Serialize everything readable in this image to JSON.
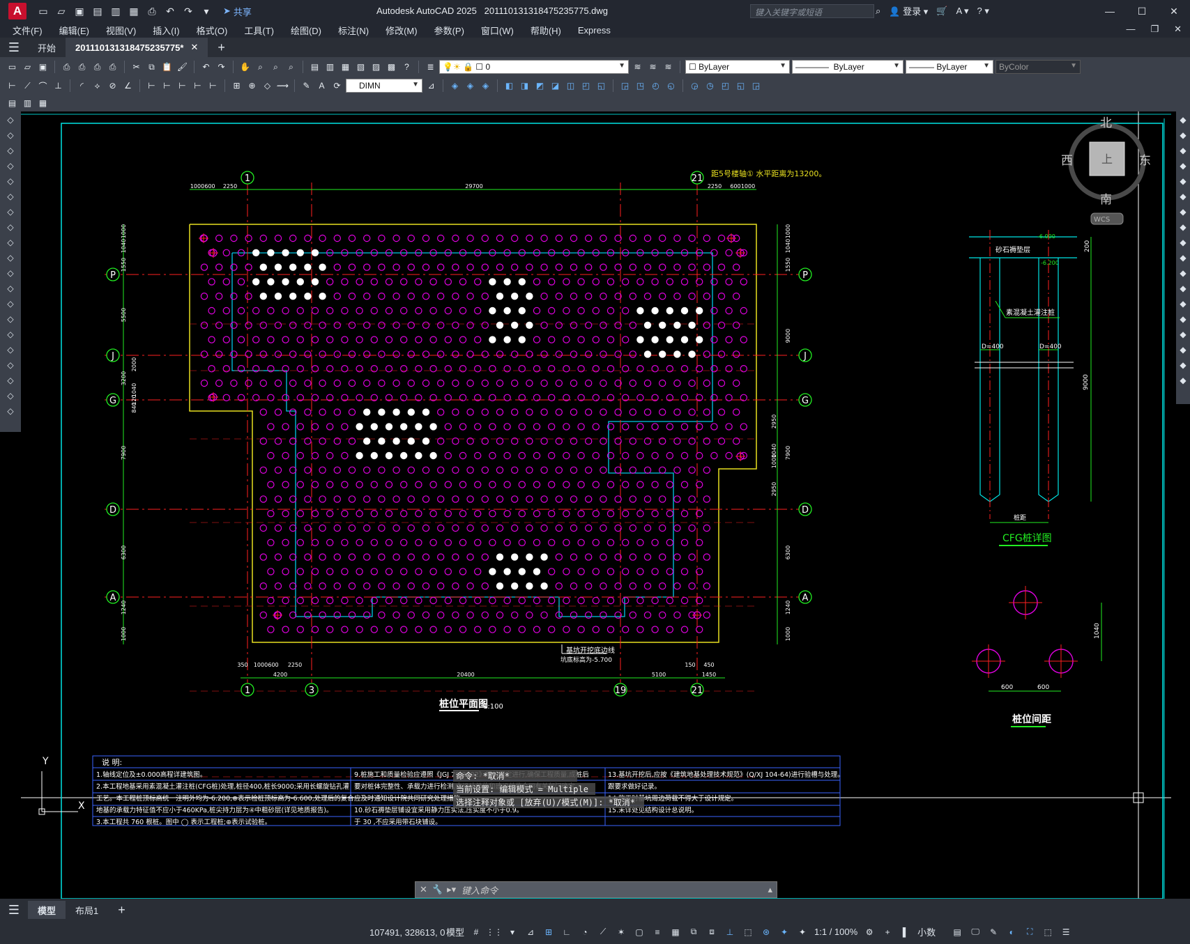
{
  "titlebar": {
    "logo": "A",
    "share": "共享",
    "app_title": "Autodesk AutoCAD 2025",
    "file_name": "20111013131847523577​5.dwg",
    "search_placeholder": "键入关键字或短语",
    "login": "登录"
  },
  "menu": [
    "文件(F)",
    "编辑(E)",
    "视图(V)",
    "插入(I)",
    "格式(O)",
    "工具(T)",
    "绘图(D)",
    "标注(N)",
    "修改(M)",
    "参数(P)",
    "窗口(W)",
    "帮助(H)",
    "Express"
  ],
  "tabs": {
    "start": "开始",
    "doc": "20111013131847523577​5*"
  },
  "toolbar": {
    "layer_value": "0",
    "color": "ByLayer",
    "linetype": "ByLayer",
    "lineweight": "ByLayer",
    "plotstyle": "ByColor",
    "dimstyle": "DIMN"
  },
  "viewcube": {
    "north": "北",
    "south": "南",
    "east": "东",
    "west": "西",
    "top": "上",
    "wcs": "WCS"
  },
  "drawing": {
    "plan_title": "桩位平面图",
    "plan_scale": "1:100",
    "detail_title": "CFG桩详图",
    "spacing_title": "桩位间距",
    "note_top": "距5号楼轴① 水平距离为13200。",
    "gravel_label": "砂石褥垫层",
    "concrete_label": "素混凝土灌注桩",
    "pile_dia_left": "D=400",
    "pile_dia_right": "D=400",
    "pile_spacing_label": "桩距",
    "depth_900": "9000",
    "elev_top": "-6.000",
    "elev_mid": "-6.200",
    "dim_200": "200",
    "dim_1040": "1040",
    "dim_600a": "600",
    "dim_600b": "600",
    "excavation_label": "基坑开挖底边线",
    "excavation_elev": "坑底标高为-5.700",
    "axes_h": [
      "P",
      "J",
      "G",
      "D",
      "A"
    ],
    "axes_v_top": [
      "1",
      "21"
    ],
    "axes_v_bottom": [
      "1",
      "3",
      "19",
      "21"
    ],
    "top_dims": [
      "1000",
      "600",
      "2250",
      "29700",
      "2250",
      "600",
      "1000"
    ],
    "bottom_dims": [
      "350",
      "1000",
      "600",
      "2250",
      "4200",
      "20400",
      "5100",
      "150",
      "450",
      "1450"
    ],
    "left_dims": [
      "1000",
      "1040",
      "1550",
      "5500",
      "3200",
      "2000",
      "1040",
      "120",
      "840",
      "7900",
      "6300",
      "1240",
      "1000"
    ],
    "right_dims": [
      "1000",
      "1040",
      "1550",
      "9000",
      "2950",
      "1040",
      "1000",
      "2950",
      "7900",
      "6300",
      "1240",
      "1000"
    ]
  },
  "notes": {
    "heading": "说 明:",
    "col1": [
      "1.轴线定位及±0.000高程详建筑图。",
      "2.本工程地基采用素混凝土灌注桩(CFG桩)处理,桩径400,桩长9000;采用长螺旋钻孔灌",
      "工艺。本工程桩顶标高统一注明外均为-6.200,⊕表示检桩顶标高为-6.600,处理后的复合",
      "地基的承载力特征值不应小于460KPa,桩尖持力层为④中粗砂层(详见地质报告)。",
      "3.本工程共 760 根桩。图中 ◯ 表示工程桩;⊕表示试验桩。"
    ],
    "col2": [
      "9.桩施工和质量检验应遵照《JGJ 79-2002》相关规定进行,确保工程质量,成桩后",
      "要对桩体完整性、承载力进行检测,由设计单位和建设单位会同有关部门确定。",
      "应及时通知设计院共同研究处理措施。",
      "10.砂石褥垫层铺设宜采用静力压实法,压实度不小于0.9。",
      "于 30 ,不应采用带石块铺设。"
    ],
    "col3": [
      "13.基坑开挖后,应按《建筑地基处理技术规范》(Q/XJ 104-64)进行验槽与处理。",
      "跟要求做好记录。",
      "14.施工时基坑周边荷载不得大于设计规定。",
      "15.未详处见结构设计总说明。"
    ]
  },
  "command": {
    "hist1": "命令: *取消*",
    "hist2": "当前设置: 编辑模式 = Multiple",
    "hist3": "选择注释对象或 [放弃(U)/模式(M)]: *取消*",
    "prompt": "键入命令"
  },
  "layout_tabs": [
    "模型",
    "布局1"
  ],
  "status": {
    "coords": "107491, 328613, 0",
    "model": "模型",
    "scale": "1:1 / 100%",
    "units": "小数"
  },
  "ucs": {
    "x": "X",
    "y": "Y"
  },
  "colors": {
    "grid_pink": "#e000e0",
    "axis_red": "#ff2020",
    "dim_green": "#22ee22",
    "outline_cyan": "#00e6e6",
    "boundary_yellow": "#e8e020",
    "border_blue": "#3aa0ff"
  }
}
